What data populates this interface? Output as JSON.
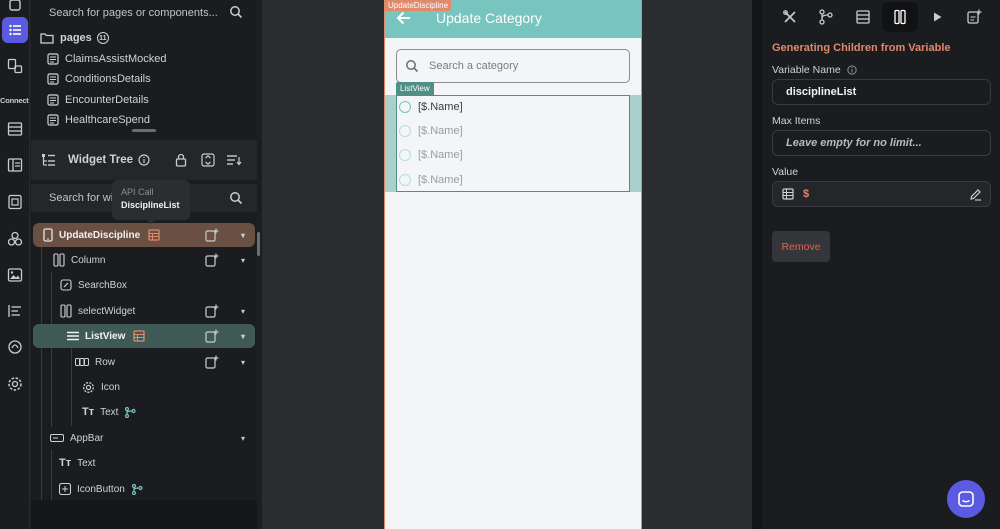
{
  "rail": {
    "connect_label": "Connect",
    "icons": [
      "pages-icon",
      "components-icon",
      "database-icon",
      "storyboard-icon",
      "theme-icon",
      "integrations-icon",
      "media-icon",
      "app-details-icon",
      "api-icon",
      "settings-icon"
    ]
  },
  "navigator": {
    "search_placeholder": "Search for pages or components...",
    "pages_label": "pages",
    "pages_count": "11",
    "pages": [
      "ClaimsAssistMocked",
      "ConditionsDetails",
      "EncounterDetails",
      "HealthcareSpend"
    ]
  },
  "widget_tree": {
    "title": "Widget Tree",
    "search_placeholder": "Search for wid",
    "tooltip": {
      "kicker": "API Call",
      "value": "DisciplineList"
    },
    "nodes": [
      {
        "label": "UpdateDiscipline"
      },
      {
        "label": "Column"
      },
      {
        "label": "SearchBox"
      },
      {
        "label": "selectWidget"
      },
      {
        "label": "ListView"
      },
      {
        "label": "Row"
      },
      {
        "label": "Icon"
      },
      {
        "label": "Text"
      },
      {
        "label": "AppBar"
      },
      {
        "label": "Text"
      },
      {
        "label": "IconButton"
      }
    ]
  },
  "canvas": {
    "page_tag": "UpdateDiscipline",
    "appbar_title": "Update Category",
    "search_placeholder": "Search a category",
    "listview_tag": "ListView",
    "list_items": [
      "[$.Name]",
      "[$.Name]",
      "[$.Name]",
      "[$.Name]"
    ]
  },
  "properties": {
    "section_title": "Generating Children from Variable",
    "variable_name_label": "Variable Name",
    "variable_name_value": "disciplineList",
    "max_items_label": "Max Items",
    "max_items_placeholder": "Leave empty for no limit...",
    "value_label": "Value",
    "value_text": "$",
    "remove_label": "Remove"
  },
  "colors": {
    "accent": "#5a5be0",
    "page_tag": "#e0896b",
    "appbar": "#78c4be",
    "listview": "#4f8f86",
    "remove": "#e0624e"
  }
}
